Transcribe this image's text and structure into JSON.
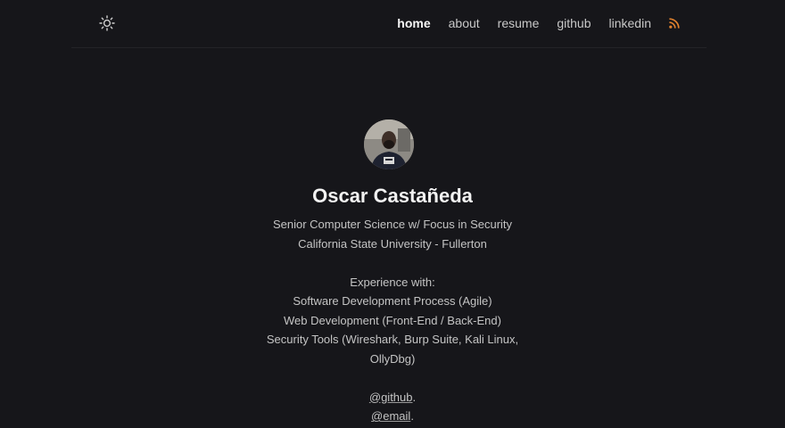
{
  "nav": {
    "items": [
      {
        "label": "home",
        "active": true
      },
      {
        "label": "about",
        "active": false
      },
      {
        "label": "resume",
        "active": false
      },
      {
        "label": "github",
        "active": false
      },
      {
        "label": "linkedin",
        "active": false
      }
    ],
    "rss_icon": "rss-icon",
    "theme_icon": "sun-icon"
  },
  "profile": {
    "name": "Oscar Castañeda",
    "subtitle_1": "Senior Computer Science w/ Focus in Security",
    "subtitle_2": "California State University - Fullerton",
    "experience_heading": "Experience with:",
    "experience_1": "Software Development Process (Agile)",
    "experience_2": "Web Development (Front-End / Back-End)",
    "experience_3": "Security Tools (Wireshark, Burp Suite, Kali Linux,",
    "experience_3b": "OllyDbg)",
    "github_link": "@github",
    "email_link": "@email",
    "link_suffix": "."
  },
  "colors": {
    "background": "#16161a",
    "rss": "#e0812d",
    "text": "#c4c4c4"
  }
}
